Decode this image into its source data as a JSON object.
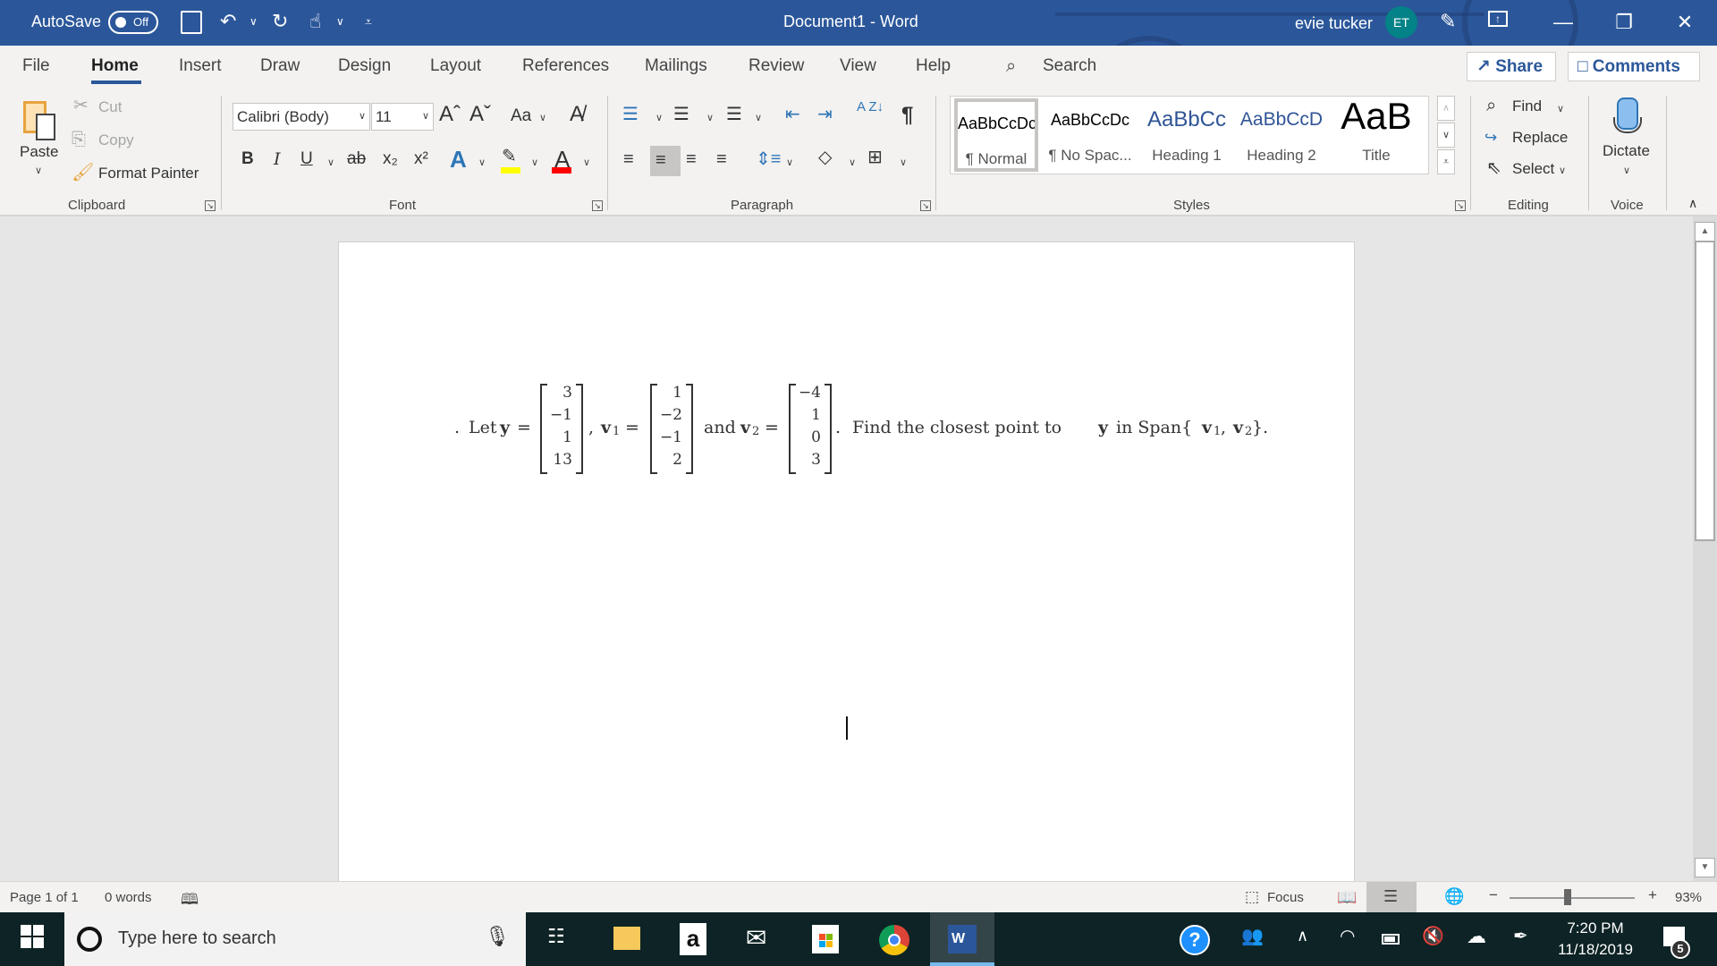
{
  "titlebar": {
    "autosave_label": "AutoSave",
    "autosave_state": "Off",
    "title": "Document1  -  Word",
    "user_name": "evie tucker",
    "user_initials": "ET",
    "icons": [
      "save-icon",
      "undo-icon",
      "redo-icon",
      "touch-mode-icon",
      "customize-qat-icon",
      "feedback-icon",
      "ribbon-display-icon",
      "minimize-icon",
      "restore-icon",
      "close-icon"
    ]
  },
  "tabs": {
    "items": [
      "File",
      "Home",
      "Insert",
      "Draw",
      "Design",
      "Layout",
      "References",
      "Mailings",
      "Review",
      "View",
      "Help"
    ],
    "active": "Home",
    "search_label": "Search",
    "share_label": "Share",
    "comments_label": "Comments"
  },
  "ribbon": {
    "clipboard": {
      "label": "Clipboard",
      "paste": "Paste",
      "cut": "Cut",
      "copy": "Copy",
      "format_painter": "Format Painter"
    },
    "font": {
      "label": "Font",
      "font_name": "Calibri (Body)",
      "font_size": "11",
      "grow": "Aˆ",
      "shrink": "Aˇ",
      "change_case": "Aa",
      "bold": "B",
      "italic": "I",
      "underline": "U",
      "strike": "ab",
      "subscript": "x₂",
      "superscript": "x²",
      "text_effects": "A",
      "font_color": "A",
      "highlight_color": "#ffff00",
      "font_color_value": "#ff0000"
    },
    "paragraph": {
      "label": "Paragraph",
      "pilcrow": "¶",
      "sort": "A Z↓"
    },
    "styles": {
      "label": "Styles",
      "items": [
        {
          "preview": "AaBbCcDc",
          "name": "¶ Normal",
          "color": "#000000",
          "selected": true
        },
        {
          "preview": "AaBbCcDc",
          "name": "¶ No Spac...",
          "color": "#000000",
          "selected": false
        },
        {
          "preview": "AaBbCc",
          "name": "Heading 1",
          "color": "#2f5496",
          "selected": false
        },
        {
          "preview": "AaBbCcD",
          "name": "Heading 2",
          "color": "#2f5496",
          "selected": false
        },
        {
          "preview": "AaB",
          "name": "Title",
          "color": "#000000",
          "selected": false
        }
      ]
    },
    "editing": {
      "label": "Editing",
      "find": "Find",
      "replace": "Replace",
      "select": "Select"
    },
    "voice": {
      "label": "Voice",
      "dictate": "Dictate"
    }
  },
  "document": {
    "lead": ".",
    "let": "Let",
    "y_sym": "y",
    "eq": "=",
    "comma": ",",
    "v1_sym": "v",
    "v1_sub": "1",
    "and": "and",
    "v2_sym": "v",
    "v2_sub": "2",
    "period": ".",
    "y_vector": [
      "3",
      "−1",
      "1",
      "13"
    ],
    "v1_vector": [
      "1",
      "−2",
      "−1",
      "2"
    ],
    "v2_vector": [
      "−4",
      "1",
      "0",
      "3"
    ],
    "question_pre": "Find the closest point to",
    "question_y": "y",
    "question_mid": "in Span{",
    "question_v1": "v",
    "question_v1_sub": "1",
    "question_sep": ", ",
    "question_v2": "v",
    "question_v2_sub": "2",
    "question_end": "}."
  },
  "statusbar": {
    "page": "Page 1 of 1",
    "words": "0 words",
    "focus": "Focus",
    "zoom_level": "93%",
    "zoom_percent": 93
  },
  "taskbar": {
    "search_placeholder": "Type here to search",
    "time": "7:20 PM",
    "date": "11/18/2019",
    "notification_count": "5"
  }
}
